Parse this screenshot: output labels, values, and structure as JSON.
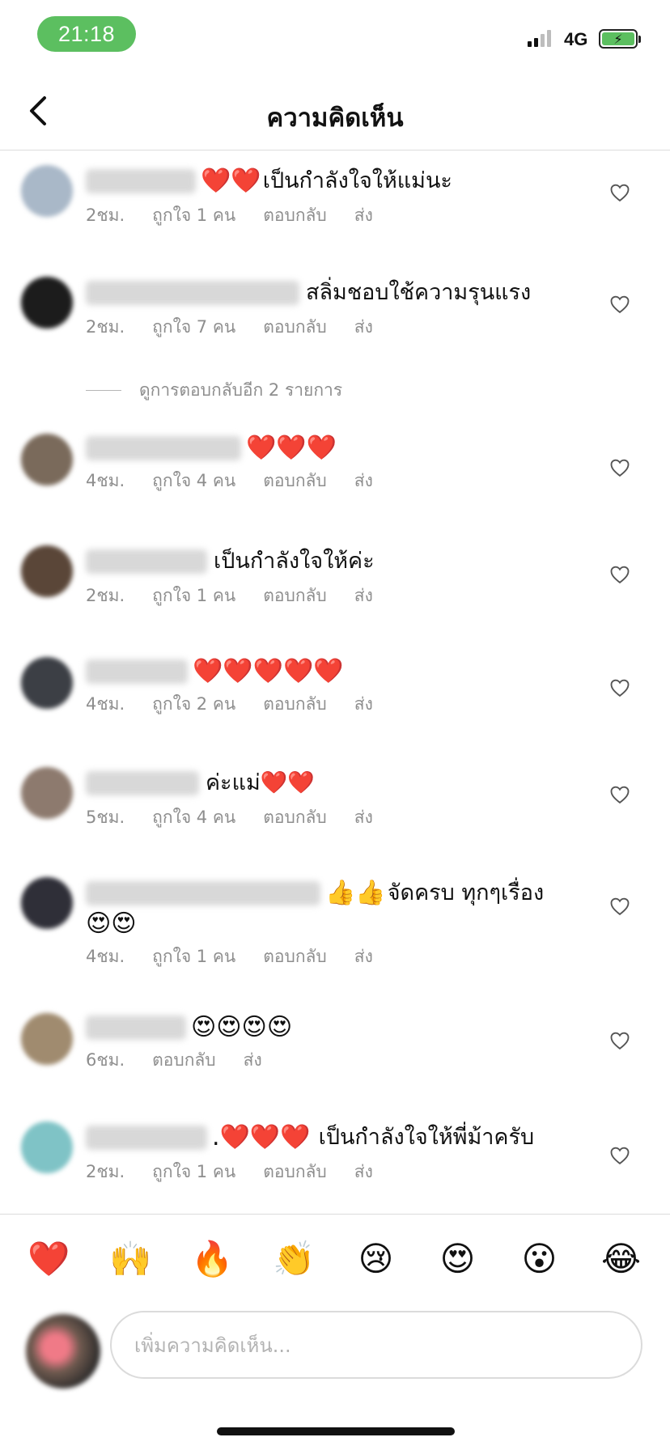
{
  "status": {
    "time": "21:18",
    "network": "4G",
    "battery_icon": "battery-charging-icon"
  },
  "header": {
    "back_icon": "chevron-left-icon",
    "title": "ความคิดเห็น"
  },
  "comments": [
    {
      "avatar_color": "#a9b8c8",
      "emoji": "❤️❤️",
      "text": "เป็นกำลังใจให้แม่นะ",
      "time": "2ชม.",
      "likes": "ถูกใจ 1 คน",
      "reply": "ตอบกลับ",
      "send": "ส่ง"
    },
    {
      "avatar_color": "#1c1c1c",
      "emoji": "",
      "text": "สลิ่มชอบใช้ความรุนแรง",
      "time": "2ชม.",
      "likes": "ถูกใจ 7 คน",
      "reply": "ตอบกลับ",
      "send": "ส่ง"
    },
    {
      "avatar_color": "#7a6a5b",
      "emoji": "❤️❤️❤️",
      "text": "",
      "time": "4ชม.",
      "likes": "ถูกใจ 4 คน",
      "reply": "ตอบกลับ",
      "send": "ส่ง"
    },
    {
      "avatar_color": "#5a4638",
      "emoji": "",
      "text": "เป็นกำลังใจให้ค่ะ",
      "time": "2ชม.",
      "likes": "ถูกใจ 1 คน",
      "reply": "ตอบกลับ",
      "send": "ส่ง"
    },
    {
      "avatar_color": "#3c3f45",
      "emoji": "❤️❤️❤️❤️❤️",
      "text": "",
      "time": "4ชม.",
      "likes": "ถูกใจ 2 คน",
      "reply": "ตอบกลับ",
      "send": "ส่ง"
    },
    {
      "avatar_color": "#8d7a6e",
      "emoji": "",
      "text": "ค่ะแม่❤️❤️",
      "time": "5ชม.",
      "likes": "ถูกใจ 4 คน",
      "reply": "ตอบกลับ",
      "send": "ส่ง"
    },
    {
      "avatar_color": "#2f2f38",
      "emoji": "👍👍",
      "text": "จัดครบ ทุกๆเรื่อง",
      "emoji2": "😍😍",
      "time": "4ชม.",
      "likes": "ถูกใจ 1 คน",
      "reply": "ตอบกลับ",
      "send": "ส่ง"
    },
    {
      "avatar_color": "#a08b6f",
      "emoji": "😍😍😍😍",
      "text": "",
      "time": "6ชม.",
      "likes": "",
      "reply": "ตอบกลับ",
      "send": "ส่ง"
    },
    {
      "avatar_color": "#7fc3c6",
      "emoji": ".❤️❤️❤️",
      "text": "เป็นกำลังใจให้พี่ม้าครับ",
      "time": "2ชม.",
      "likes": "ถูกใจ 1 คน",
      "reply": "ตอบกลับ",
      "send": "ส่ง"
    }
  ],
  "view_more": "ดูการตอบกลับอีก 2 รายการ",
  "reactions": [
    "❤️",
    "🙌",
    "🔥",
    "👏",
    "😢",
    "😍",
    "😮",
    "😂"
  ],
  "composer": {
    "placeholder": "เพิ่มความคิดเห็น..."
  }
}
